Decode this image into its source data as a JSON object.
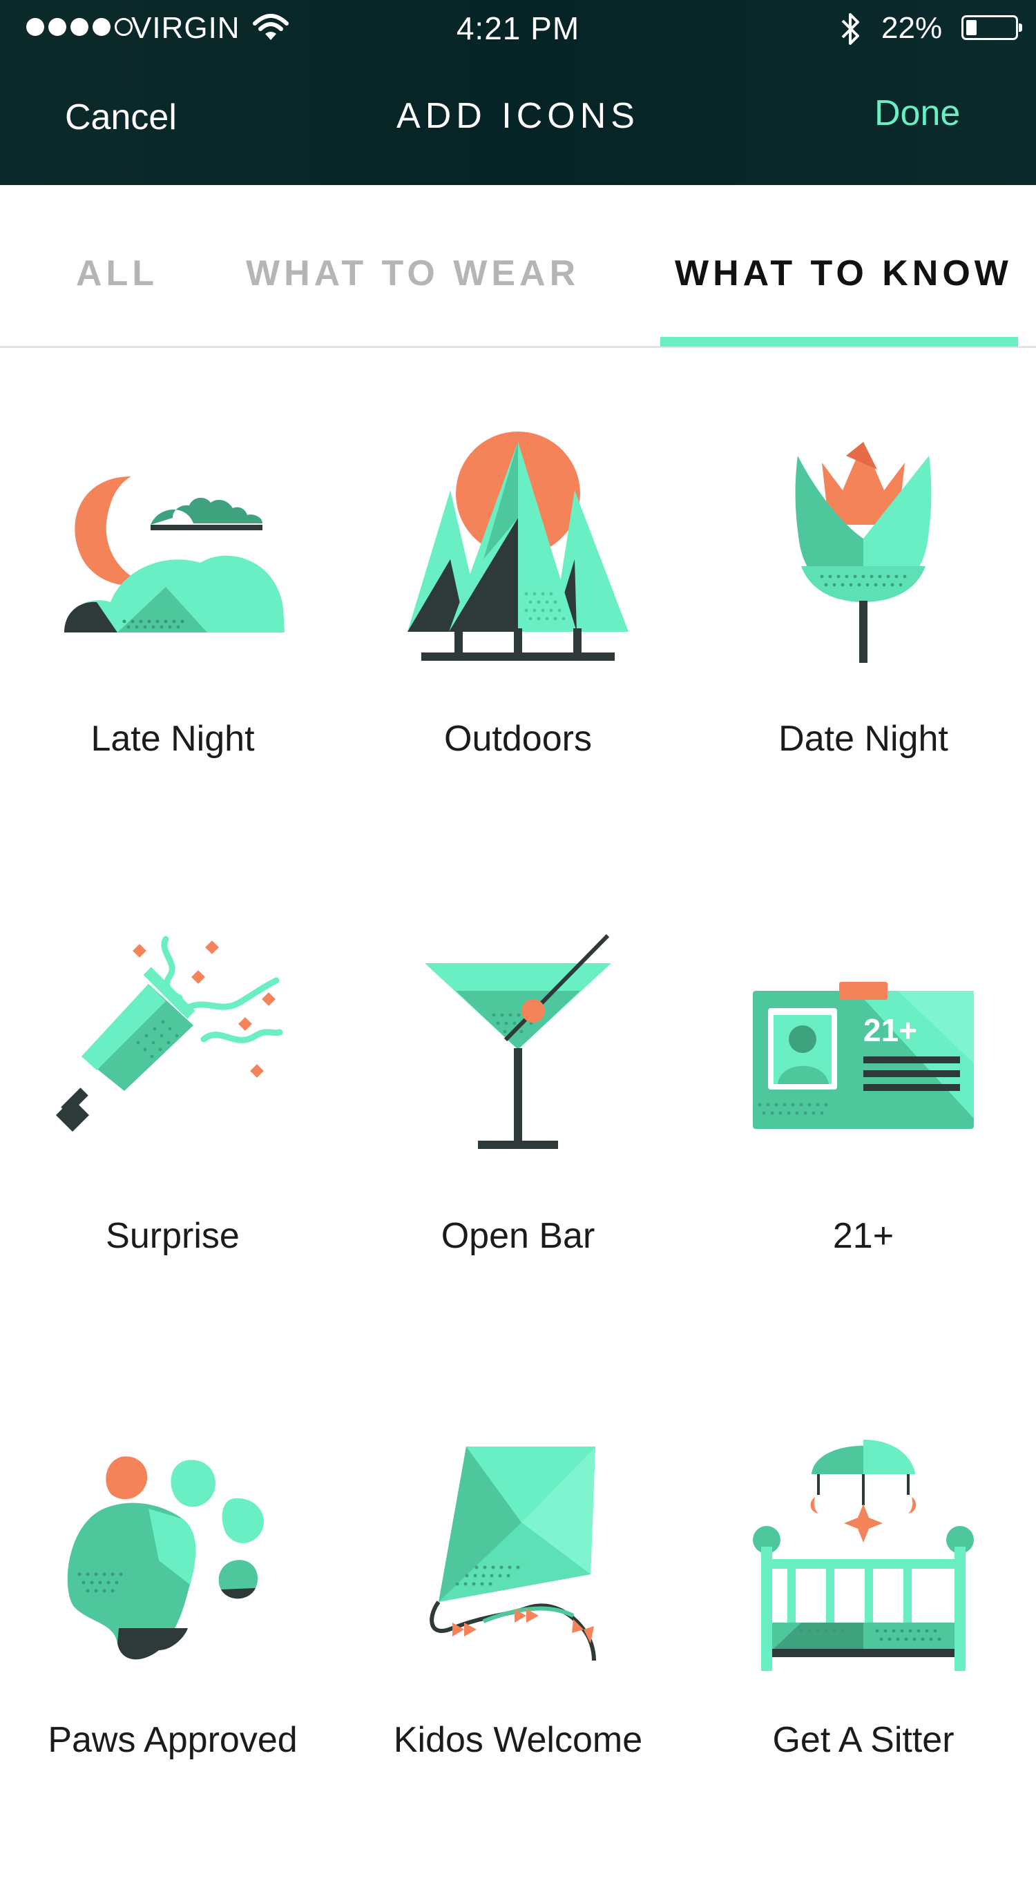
{
  "status_bar": {
    "carrier": "VIRGIN",
    "time": "4:21 PM",
    "battery_percent": "22%",
    "battery_level": 0.22
  },
  "nav": {
    "cancel_label": "Cancel",
    "title": "ADD ICONS",
    "done_label": "Done"
  },
  "tabs": [
    {
      "label": "ALL",
      "active": false
    },
    {
      "label": "WHAT TO WEAR",
      "active": false
    },
    {
      "label": "WHAT TO KNOW",
      "active": true
    }
  ],
  "icons": [
    {
      "label": "Late Night",
      "icon": "moon-cloud-icon"
    },
    {
      "label": "Outdoors",
      "icon": "trees-icon"
    },
    {
      "label": "Date Night",
      "icon": "tulip-icon"
    },
    {
      "label": "Surprise",
      "icon": "party-popper-icon"
    },
    {
      "label": "Open Bar",
      "icon": "martini-icon"
    },
    {
      "label": "21+",
      "icon": "id-card-icon",
      "badge_text": "21+"
    },
    {
      "label": "Paws Approved",
      "icon": "paw-print-icon"
    },
    {
      "label": "Kidos Welcome",
      "icon": "kite-icon"
    },
    {
      "label": "Get A Sitter",
      "icon": "crib-icon"
    }
  ],
  "colors": {
    "header_bg": "#062425",
    "accent": "#6aeec4",
    "mint": "#6aeec4",
    "mid_green": "#4fc79d",
    "dark": "#2e3a3a",
    "orange": "#f5835a"
  }
}
